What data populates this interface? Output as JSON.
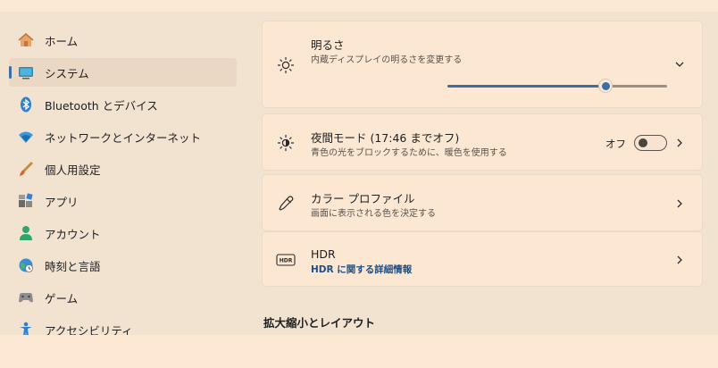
{
  "sidebar": {
    "items": [
      {
        "label": "ホーム",
        "icon": "home-icon"
      },
      {
        "label": "システム",
        "icon": "system-icon",
        "selected": true
      },
      {
        "label": "Bluetooth とデバイス",
        "icon": "bluetooth-icon"
      },
      {
        "label": "ネットワークとインターネット",
        "icon": "network-icon"
      },
      {
        "label": "個人用設定",
        "icon": "brush-icon"
      },
      {
        "label": "アプリ",
        "icon": "apps-icon"
      },
      {
        "label": "アカウント",
        "icon": "account-icon"
      },
      {
        "label": "時刻と言語",
        "icon": "time-language-icon"
      },
      {
        "label": "ゲーム",
        "icon": "gaming-icon"
      },
      {
        "label": "アクセシビリティ",
        "icon": "accessibility-icon"
      }
    ]
  },
  "main": {
    "brightness": {
      "title": "明るさ",
      "subtitle": "内蔵ディスプレイの明るさを変更する",
      "level_fraction": 0.72
    },
    "night_light": {
      "title": "夜間モード (17:46 までオフ)",
      "subtitle": "青色の光をブロックするために、暖色を使用する",
      "toggle_label": "オフ",
      "toggle_on": false
    },
    "color_profile": {
      "title": "カラー プロファイル",
      "subtitle": "画面に表示される色を決定する"
    },
    "hdr": {
      "title": "HDR",
      "link": "HDR に関する詳細情報",
      "badge": "HDR"
    },
    "scale_section_heading": "拡大縮小とレイアウト"
  },
  "colors": {
    "accent": "#3d6ea3",
    "background": "#f2e3d1",
    "card": "#fbe7d2",
    "outer": "#fde8d4"
  }
}
